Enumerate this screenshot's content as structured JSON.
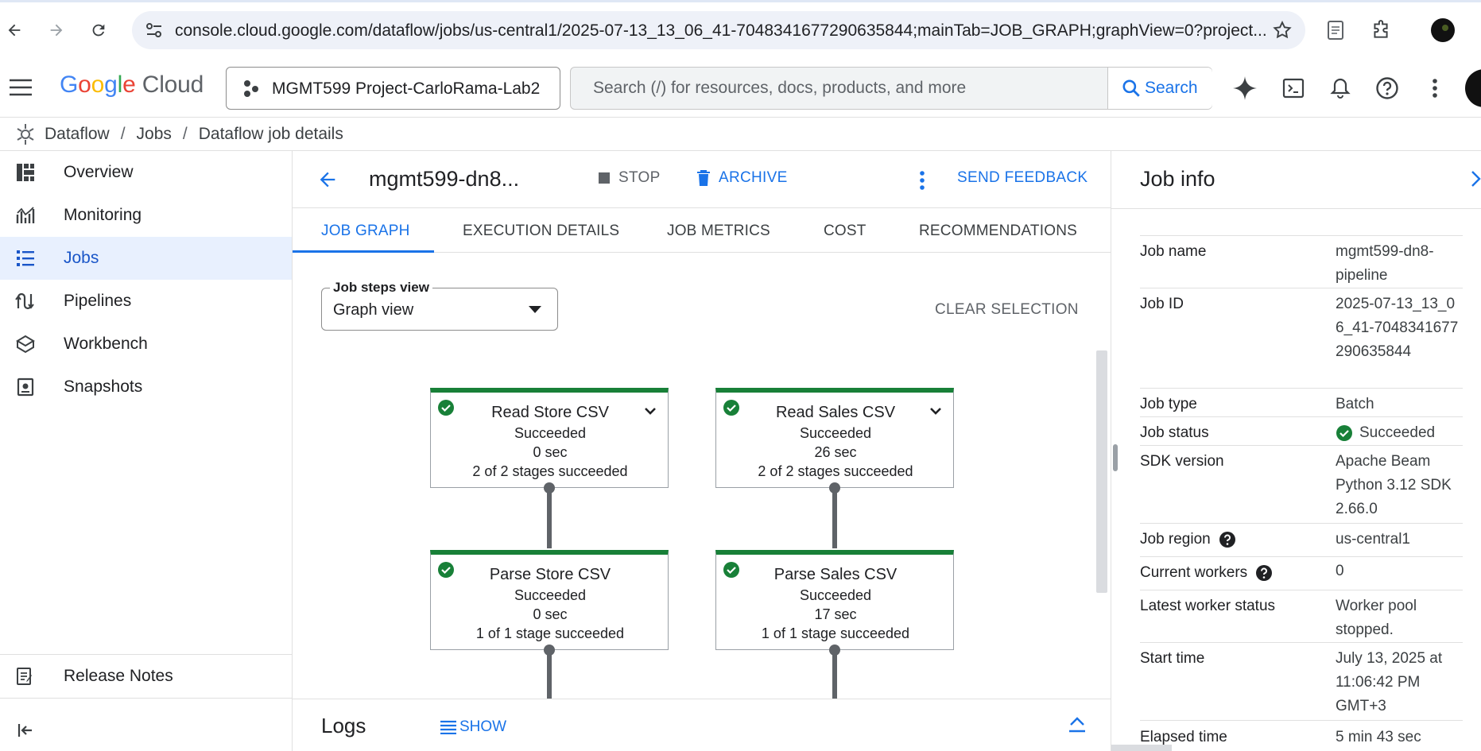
{
  "browser": {
    "url": "console.cloud.google.com/dataflow/jobs/us-central1/2025-07-13_13_06_41-7048341677290635844;mainTab=JOB_GRAPH;graphView=0?project..."
  },
  "header": {
    "logo_google": "Google",
    "logo_cloud": "Cloud",
    "project": "MGMT599 Project-CarloRama-Lab2",
    "search_placeholder": "Search (/) for resources, docs, products, and more",
    "search_button": "Search"
  },
  "breadcrumb": {
    "items": [
      "Dataflow",
      "Jobs",
      "Dataflow job details"
    ]
  },
  "sidebar": {
    "items": [
      {
        "label": "Overview",
        "icon": "overview-icon"
      },
      {
        "label": "Monitoring",
        "icon": "monitoring-icon"
      },
      {
        "label": "Jobs",
        "icon": "list-icon"
      },
      {
        "label": "Pipelines",
        "icon": "pipelines-icon"
      },
      {
        "label": "Workbench",
        "icon": "workbench-icon"
      },
      {
        "label": "Snapshots",
        "icon": "snapshots-icon"
      }
    ],
    "release_notes": "Release Notes"
  },
  "job": {
    "title": "mgmt599-dn8...",
    "stop": "STOP",
    "archive": "ARCHIVE",
    "send_feedback": "SEND FEEDBACK"
  },
  "tabs": [
    "JOB GRAPH",
    "EXECUTION DETAILS",
    "JOB METRICS",
    "COST",
    "RECOMMENDATIONS"
  ],
  "graph": {
    "steps_view_label": "Job steps view",
    "steps_view_value": "Graph view",
    "clear_selection": "CLEAR SELECTION",
    "nodes": [
      {
        "name": "Read Store CSV",
        "status": "Succeeded",
        "time": "0 sec",
        "stages": "2 of 2 stages succeeded"
      },
      {
        "name": "Read Sales CSV",
        "status": "Succeeded",
        "time": "26 sec",
        "stages": "2 of 2 stages succeeded"
      },
      {
        "name": "Parse Store CSV",
        "status": "Succeeded",
        "time": "0 sec",
        "stages": "1 of 1 stage succeeded"
      },
      {
        "name": "Parse Sales CSV",
        "status": "Succeeded",
        "time": "17 sec",
        "stages": "1 of 1 stage succeeded"
      }
    ]
  },
  "logs": {
    "title": "Logs",
    "show": "SHOW"
  },
  "job_info": {
    "title": "Job info",
    "rows": [
      {
        "key": "Job name",
        "value": "mgmt599-dn8-pipeline"
      },
      {
        "key": "Job ID",
        "value": "2025-07-13_13_06_41-7048341677290635844"
      },
      {
        "key": "Job type",
        "value": "Batch"
      },
      {
        "key": "Job status",
        "value": "Succeeded"
      },
      {
        "key": "SDK version",
        "value": "Apache Beam Python 3.12 SDK 2.66.0"
      },
      {
        "key": "Job region",
        "value": "us-central1"
      },
      {
        "key": "Current workers",
        "value": "0"
      },
      {
        "key": "Latest worker status",
        "value": "Worker pool stopped."
      },
      {
        "key": "Start time",
        "value": "July 13, 2025 at 11:06:42 PM GMT+3"
      },
      {
        "key": "Elapsed time",
        "value": "5 min 43 sec"
      }
    ]
  },
  "colors": {
    "accent": "#1a73e8",
    "success": "#188038",
    "active_nav_bg": "#e8f0fe"
  }
}
